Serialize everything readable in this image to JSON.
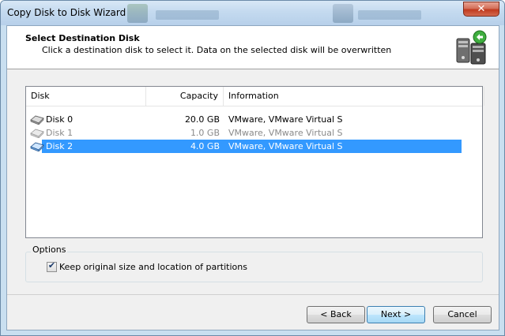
{
  "window": {
    "title": "Copy Disk to Disk Wizard"
  },
  "header": {
    "title": "Select Destination Disk",
    "subtitle": "Click a destination disk to select it. Data on the selected disk will be overwritten"
  },
  "disk_list": {
    "columns": [
      "Disk",
      "Capacity",
      "Information"
    ],
    "rows": [
      {
        "name": "Disk 0",
        "capacity": "20.0 GB",
        "info": "VMware, VMware Virtual S",
        "state": "normal"
      },
      {
        "name": "Disk 1",
        "capacity": "1.0 GB",
        "info": "VMware, VMware Virtual S",
        "state": "disabled"
      },
      {
        "name": "Disk 2",
        "capacity": "4.0 GB",
        "info": "VMware, VMware Virtual S",
        "state": "selected"
      }
    ]
  },
  "options": {
    "label": "Options",
    "keep_size": {
      "label": "Keep original size and location of partitions",
      "checked": true
    }
  },
  "buttons": {
    "back": "< Back",
    "next": "Next >",
    "cancel": "Cancel"
  },
  "colors": {
    "selection": "#3399ff",
    "close_button": "#c03a1f"
  },
  "icons": {
    "row_icon": "disk-drive-icon",
    "wizard_icon": "disk-copy-icon",
    "close": "close-icon"
  }
}
